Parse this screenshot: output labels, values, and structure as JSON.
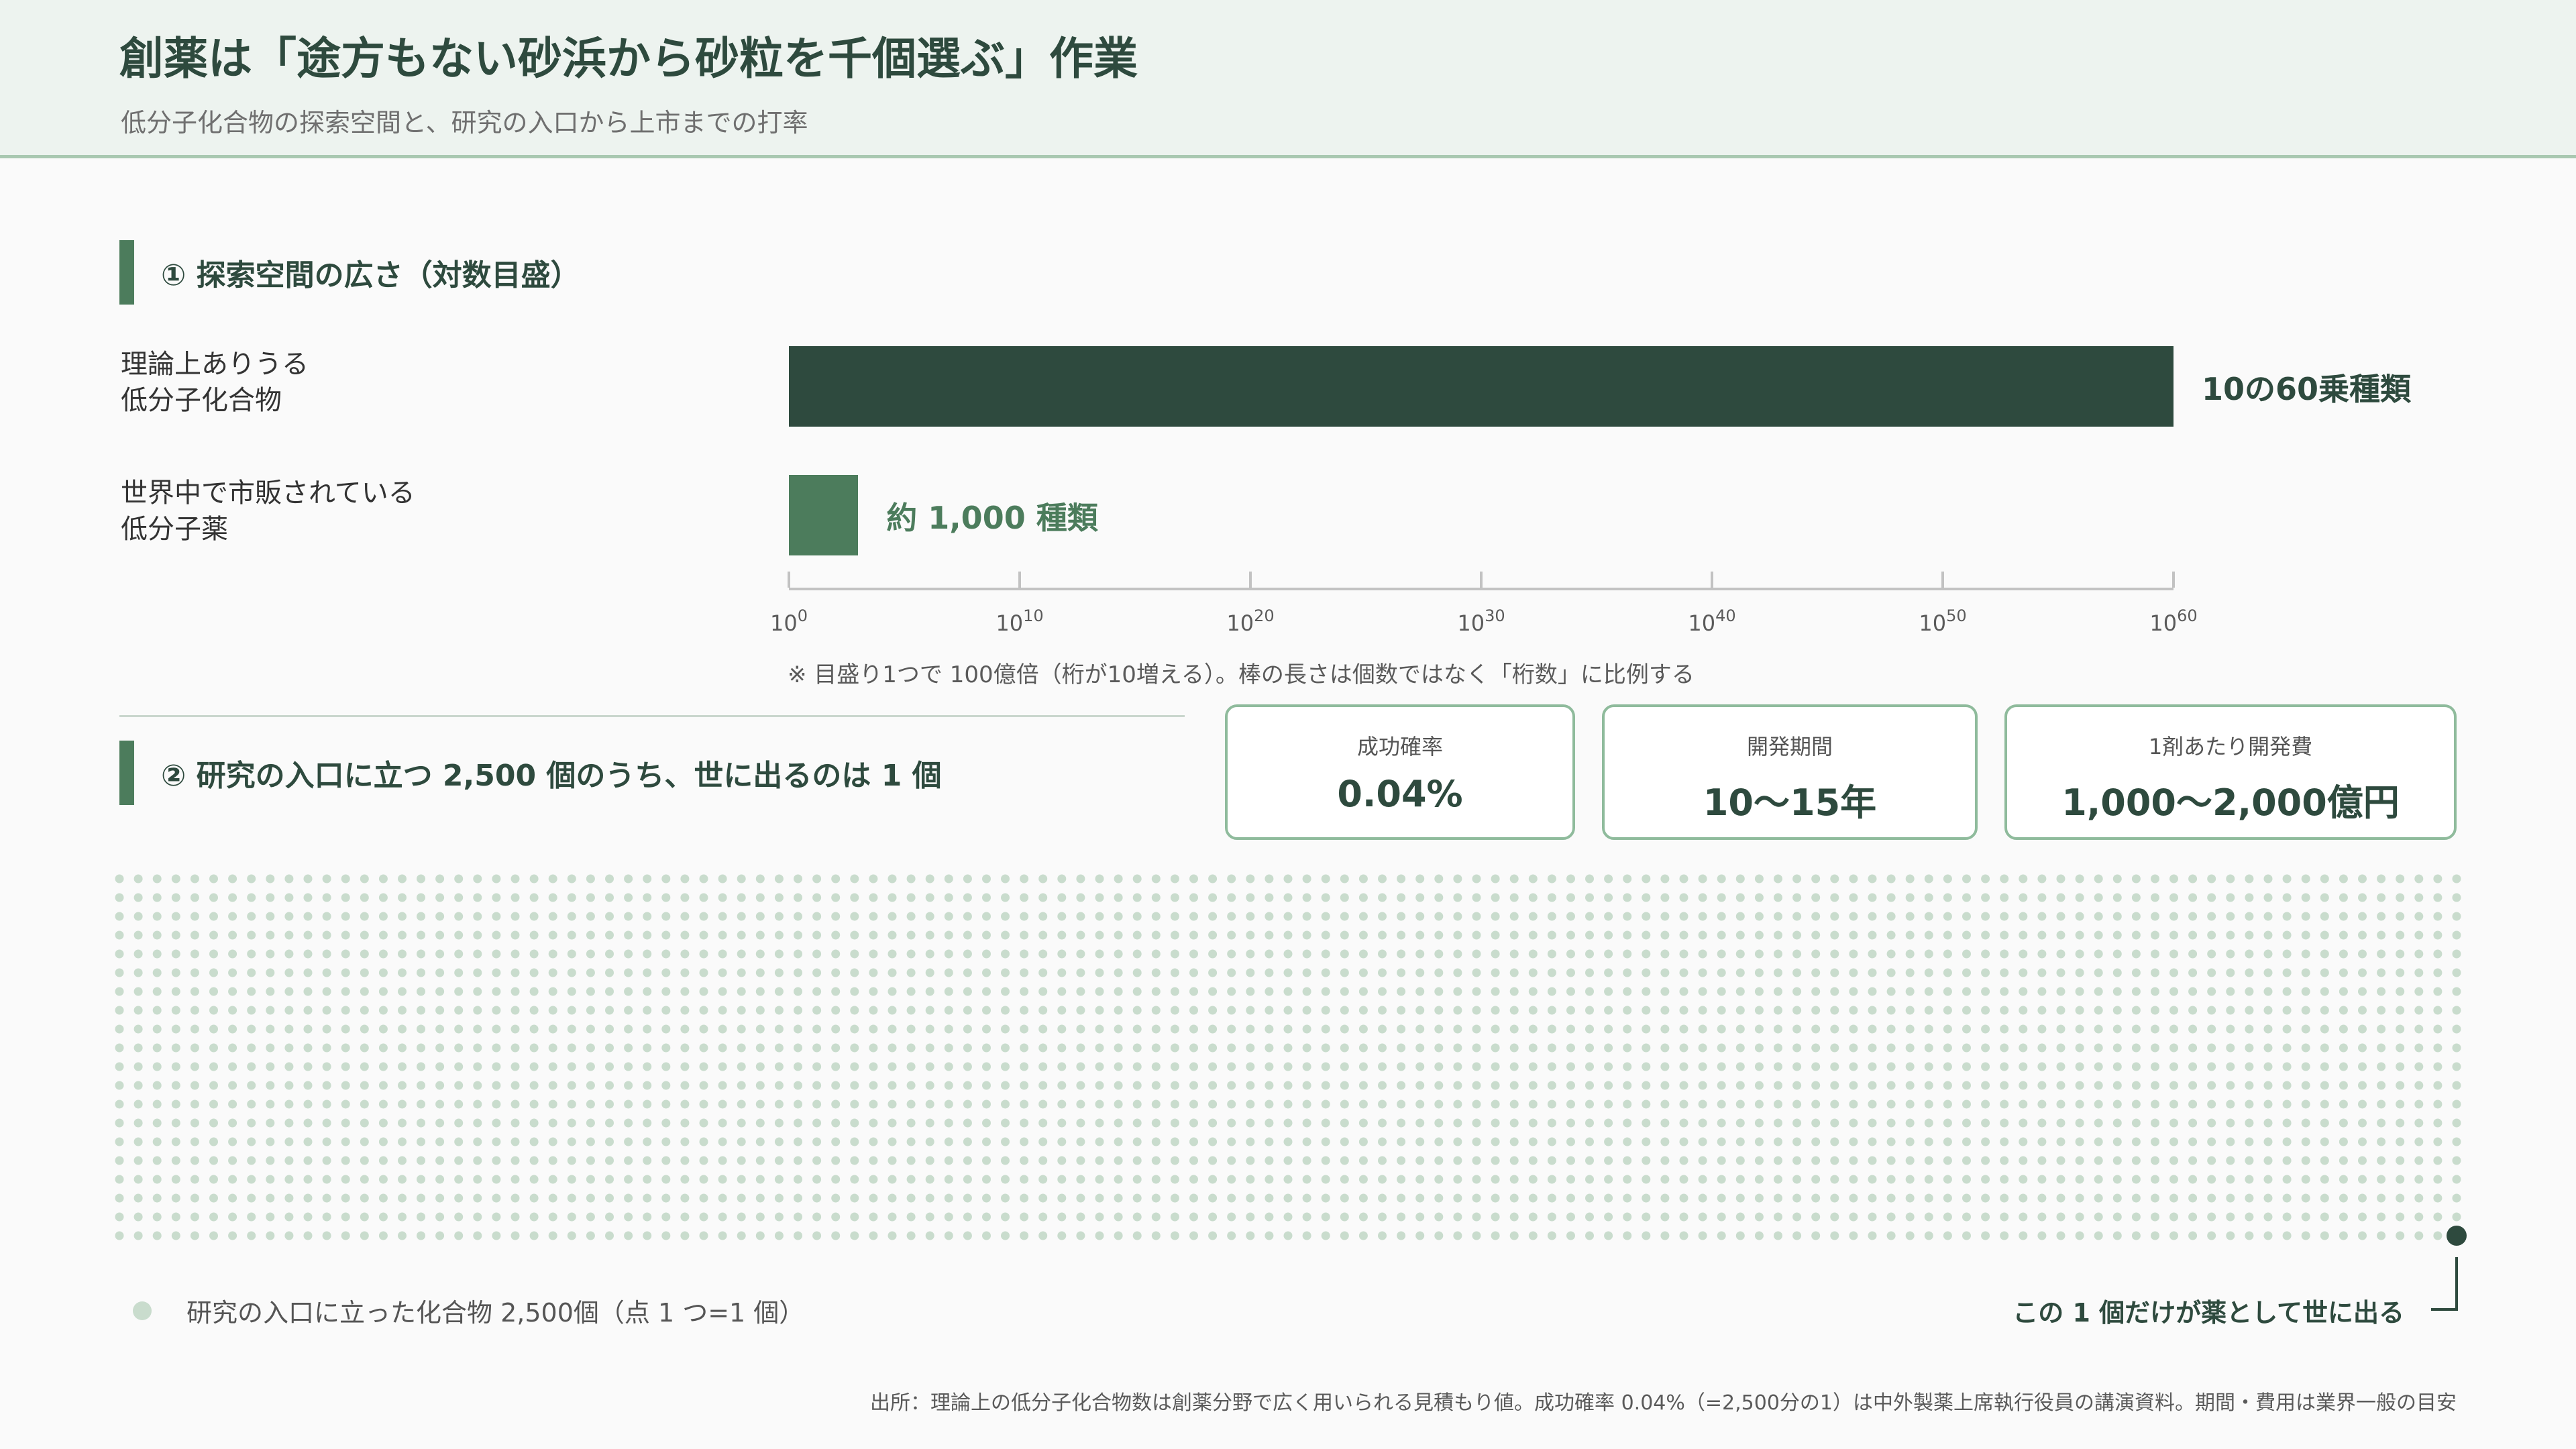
{
  "header": {
    "title": "創薬は「途方もない砂浜から砂粒を千個選ぶ」作業",
    "subtitle": "低分子化合物の探索空間と、研究の入口から上市までの打率"
  },
  "section1": {
    "heading": "① 探索空間の広さ（対数目盛）",
    "axis_note": "※ 目盛り1つで 100億倍（桁が10増える）。棒の長さは個数ではなく「桁数」に比例する"
  },
  "section2": {
    "heading": "② 研究の入口に立つ 2,500 個のうち、世に出るのは 1 個",
    "stats": [
      {
        "label": "成功確率",
        "value": "0.04%"
      },
      {
        "label": "開発期間",
        "value": "10〜15年"
      },
      {
        "label": "1剤あたり開発費",
        "value": "1,000〜2,000億円"
      }
    ],
    "legend_text": "研究の入口に立った化合物 2,500個（点 1 つ=1 個）",
    "callout_text": "この 1 個だけが薬として世に出る"
  },
  "source": "出所：理論上の低分子化合物数は創薬分野で広く用いられる見積もり値。成功確率 0.04%（=2,500分の1）は中外製薬上席執行役員の講演資料。期間・費用は業界一般の目安",
  "colors": {
    "dark_green": "#2e4a3e",
    "mid_green": "#4c7c5c",
    "light_dot": "#c9dccd",
    "axis": "#c2c2c2"
  },
  "chart_data": [
    {
      "type": "bar",
      "orientation": "horizontal",
      "scale": "log10",
      "categories": [
        "理論上ありうる低分子化合物",
        "世界中で市販されている低分子薬"
      ],
      "category_lines": [
        [
          "理論上ありうる",
          "低分子化合物"
        ],
        [
          "世界中で市販されている",
          "低分子薬"
        ]
      ],
      "values": [
        1e+60,
        1000
      ],
      "exponents": [
        60,
        3
      ],
      "value_labels": [
        "10の60乗種類",
        "約 1,000 種類"
      ],
      "bar_colors": [
        "#2e4a3e",
        "#4c7c5c"
      ],
      "xlim_exponent": [
        0,
        60
      ],
      "xticks_exponent": [
        0,
        10,
        20,
        30,
        40,
        50,
        60
      ],
      "tick_base": "10"
    },
    {
      "type": "waffle",
      "total": 2500,
      "highlighted": 1,
      "rows": 20,
      "columns": 125,
      "dot_color": "#c9dccd",
      "highlight_color": "#2e4a3e"
    }
  ]
}
